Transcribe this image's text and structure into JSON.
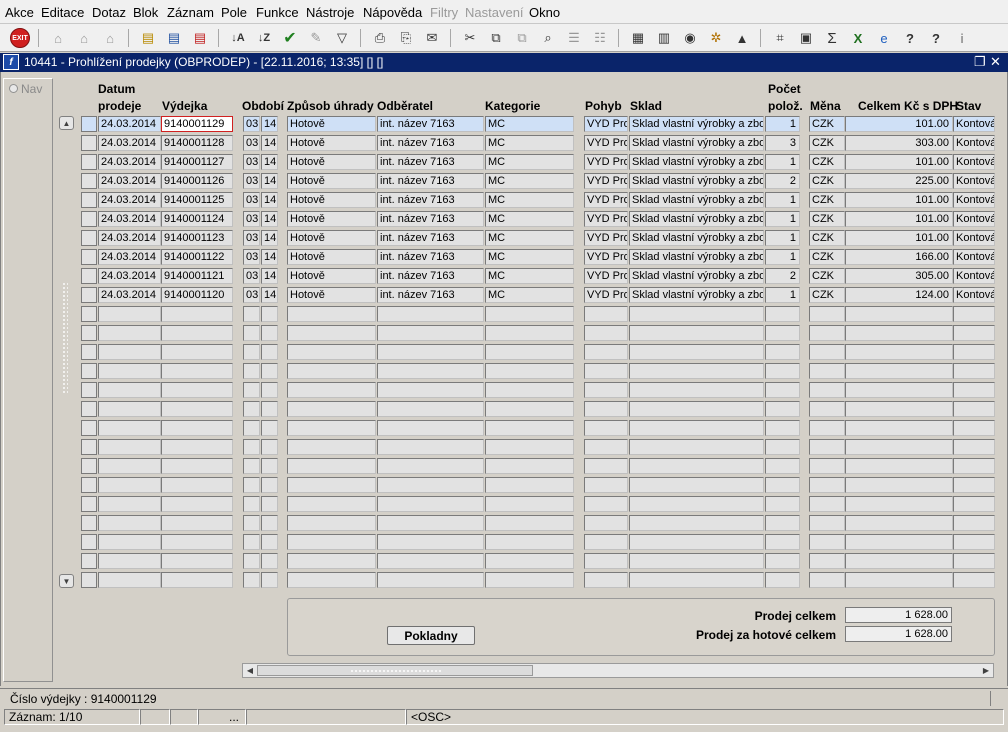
{
  "menu": [
    "Akce",
    "Editace",
    "Dotaz",
    "Blok",
    "Záznam",
    "Pole",
    "Funkce",
    "Nástroje",
    "Nápověda",
    "Filtry",
    "Nastavení",
    "Okno"
  ],
  "menu_disabled": [
    "Filtry",
    "Nastavení"
  ],
  "toolbar": {
    "exit_label": "EXIT"
  },
  "window": {
    "title": "10441 - Prohlížení prodejky (OBPRODEP) - [22.11.2016; 13:35]  [] []",
    "restore_glyph": "❐",
    "close_glyph": "✕"
  },
  "nav": {
    "label": "Nav"
  },
  "columns": {
    "datum_line1": "Datum",
    "datum_line2": "prodeje",
    "vydejka": "Výdejka",
    "obdobi": "Období",
    "zpusob": "Způsob úhrady",
    "odberatel": "Odběratel",
    "kategorie": "Kategorie",
    "pohyb": "Pohyb",
    "sklad": "Sklad",
    "pocet_line1": "Počet",
    "pocet_line2": "polož.",
    "mena": "Měna",
    "celkem": "Celkem Kč s DPH",
    "stav": "Stav"
  },
  "rows": [
    {
      "datum": "24.03.2014",
      "vydejka": "9140001129",
      "ob1": "03",
      "ob2": "14",
      "zpusob": "Hotově",
      "odberatel": "int. název 7163",
      "kategorie": "MC",
      "pohyb": "VYD Pro",
      "sklad": "Sklad vlastní výrobky a zbo",
      "pocet": "1",
      "mena": "CZK",
      "celkem": "101.00",
      "stav": "Kontová"
    },
    {
      "datum": "24.03.2014",
      "vydejka": "9140001128",
      "ob1": "03",
      "ob2": "14",
      "zpusob": "Hotově",
      "odberatel": "int. název 7163",
      "kategorie": "MC",
      "pohyb": "VYD Pro",
      "sklad": "Sklad vlastní výrobky a zbo",
      "pocet": "3",
      "mena": "CZK",
      "celkem": "303.00",
      "stav": "Kontová"
    },
    {
      "datum": "24.03.2014",
      "vydejka": "9140001127",
      "ob1": "03",
      "ob2": "14",
      "zpusob": "Hotově",
      "odberatel": "int. název 7163",
      "kategorie": "MC",
      "pohyb": "VYD Pro",
      "sklad": "Sklad vlastní výrobky a zbo",
      "pocet": "1",
      "mena": "CZK",
      "celkem": "101.00",
      "stav": "Kontová"
    },
    {
      "datum": "24.03.2014",
      "vydejka": "9140001126",
      "ob1": "03",
      "ob2": "14",
      "zpusob": "Hotově",
      "odberatel": "int. název 7163",
      "kategorie": "MC",
      "pohyb": "VYD Pro",
      "sklad": "Sklad vlastní výrobky a zbo",
      "pocet": "2",
      "mena": "CZK",
      "celkem": "225.00",
      "stav": "Kontová"
    },
    {
      "datum": "24.03.2014",
      "vydejka": "9140001125",
      "ob1": "03",
      "ob2": "14",
      "zpusob": "Hotově",
      "odberatel": "int. název 7163",
      "kategorie": "MC",
      "pohyb": "VYD Pro",
      "sklad": "Sklad vlastní výrobky a zbo",
      "pocet": "1",
      "mena": "CZK",
      "celkem": "101.00",
      "stav": "Kontová"
    },
    {
      "datum": "24.03.2014",
      "vydejka": "9140001124",
      "ob1": "03",
      "ob2": "14",
      "zpusob": "Hotově",
      "odberatel": "int. název 7163",
      "kategorie": "MC",
      "pohyb": "VYD Pro",
      "sklad": "Sklad vlastní výrobky a zbo",
      "pocet": "1",
      "mena": "CZK",
      "celkem": "101.00",
      "stav": "Kontová"
    },
    {
      "datum": "24.03.2014",
      "vydejka": "9140001123",
      "ob1": "03",
      "ob2": "14",
      "zpusob": "Hotově",
      "odberatel": "int. název 7163",
      "kategorie": "MC",
      "pohyb": "VYD Pro",
      "sklad": "Sklad vlastní výrobky a zbo",
      "pocet": "1",
      "mena": "CZK",
      "celkem": "101.00",
      "stav": "Kontová"
    },
    {
      "datum": "24.03.2014",
      "vydejka": "9140001122",
      "ob1": "03",
      "ob2": "14",
      "zpusob": "Hotově",
      "odberatel": "int. název 7163",
      "kategorie": "MC",
      "pohyb": "VYD Pro",
      "sklad": "Sklad vlastní výrobky a zbo",
      "pocet": "1",
      "mena": "CZK",
      "celkem": "166.00",
      "stav": "Kontová"
    },
    {
      "datum": "24.03.2014",
      "vydejka": "9140001121",
      "ob1": "03",
      "ob2": "14",
      "zpusob": "Hotově",
      "odberatel": "int. název 7163",
      "kategorie": "MC",
      "pohyb": "VYD Pro",
      "sklad": "Sklad vlastní výrobky a zbo",
      "pocet": "2",
      "mena": "CZK",
      "celkem": "305.00",
      "stav": "Kontová"
    },
    {
      "datum": "24.03.2014",
      "vydejka": "9140001120",
      "ob1": "03",
      "ob2": "14",
      "zpusob": "Hotově",
      "odberatel": "int. název 7163",
      "kategorie": "MC",
      "pohyb": "VYD Pro",
      "sklad": "Sklad vlastní výrobky a zbo",
      "pocet": "1",
      "mena": "CZK",
      "celkem": "124.00",
      "stav": "Kontová"
    }
  ],
  "empty_row_count": 15,
  "summary": {
    "pokladny_label": "Pokladny",
    "prodej_celkem_label": "Prodej celkem",
    "prodej_celkem_value": "1 628.00",
    "prodej_hotove_label": "Prodej za hotové celkem",
    "prodej_hotove_value": "1 628.00"
  },
  "status": {
    "field_text": "Číslo výdejky : 9140001129",
    "record_text": "Záznam: 1/10",
    "ellipsis": "...",
    "mode_text": "<OSC>"
  },
  "colors": {
    "titlebar": "#0a246a",
    "current_row": "#cfe0f6",
    "focus_border": "#d02020",
    "cell": "#e2e2e2"
  }
}
